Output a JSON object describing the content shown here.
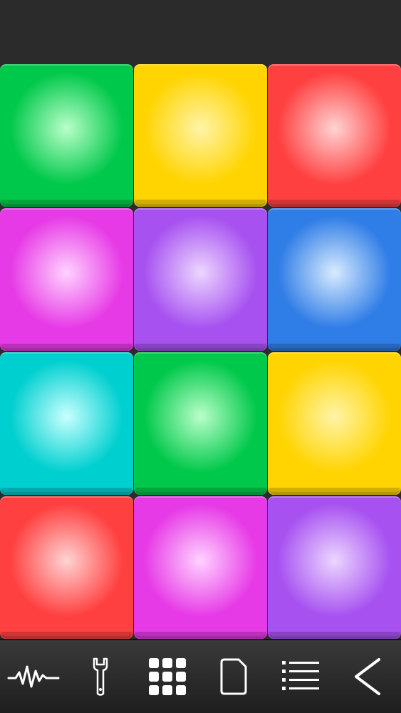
{
  "pads": [
    {
      "color": "green",
      "base": "#00c84a",
      "glow": "#b9ffc9"
    },
    {
      "color": "yellow",
      "base": "#ffd400",
      "glow": "#fff4a8"
    },
    {
      "color": "red",
      "base": "#ff4040",
      "glow": "#ffd3d3"
    },
    {
      "color": "magenta",
      "base": "#e63ae6",
      "glow": "#ffd2ff"
    },
    {
      "color": "purple",
      "base": "#a752f0",
      "glow": "#ecd6ff"
    },
    {
      "color": "blue",
      "base": "#2f7de6",
      "glow": "#d8ebff"
    },
    {
      "color": "cyan",
      "base": "#00cfcf",
      "glow": "#c9ffff"
    },
    {
      "color": "green",
      "base": "#00c84a",
      "glow": "#b9ffc9"
    },
    {
      "color": "yellow",
      "base": "#ffd400",
      "glow": "#fff4a8"
    },
    {
      "color": "red",
      "base": "#ff4040",
      "glow": "#ffd3d3"
    },
    {
      "color": "magenta",
      "base": "#e63ae6",
      "glow": "#ffd2ff"
    },
    {
      "color": "purple",
      "base": "#a752f0",
      "glow": "#ecd6ff"
    }
  ],
  "toolbar": {
    "items": [
      {
        "icon": "waveform-icon"
      },
      {
        "icon": "wrench-icon"
      },
      {
        "icon": "pad-grid-icon"
      },
      {
        "icon": "document-icon"
      },
      {
        "icon": "list-icon"
      },
      {
        "icon": "back-arrow-icon"
      }
    ]
  }
}
